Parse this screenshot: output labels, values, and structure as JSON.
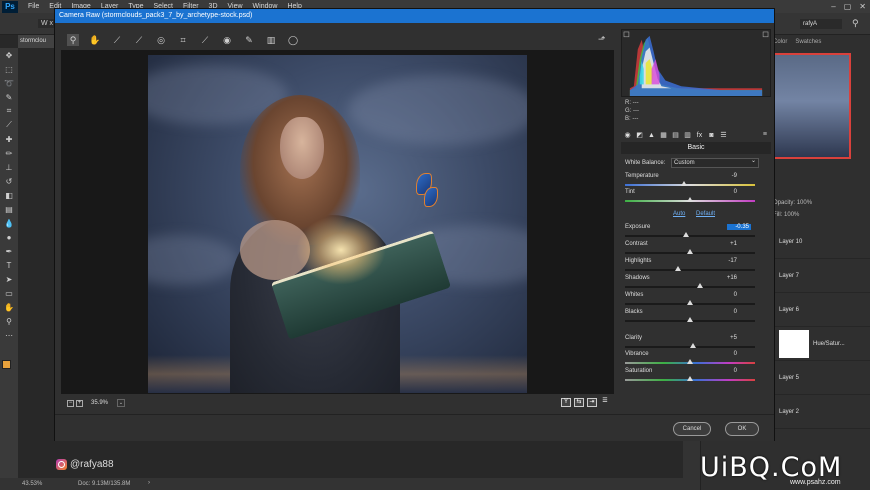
{
  "menubar": {
    "logo": "Ps",
    "items": [
      "File",
      "Edit",
      "Image",
      "Layer",
      "Type",
      "Select",
      "Filter",
      "3D",
      "View",
      "Window",
      "Help"
    ]
  },
  "options_bar": {
    "partial_label": "W x H",
    "user": "rafyA"
  },
  "doc_tab": "stormclou",
  "right_panel": {
    "tabs": [
      "Color",
      "Swatches"
    ],
    "opacity_label": "Opacity:",
    "opacity_value": "100%",
    "fill_label": "Fill:",
    "fill_value": "100%",
    "layers": [
      "Layer 10",
      "Layer 7",
      "Layer 6",
      "Hue/Satur...",
      "Layer 5",
      "Layer 2"
    ]
  },
  "camera_raw": {
    "title": "Camera Raw (stormclouds_pack3_7_by_archetype-stock.psd)",
    "zoom": "35.9%",
    "histogram": {
      "r": "R:",
      "g": "G:",
      "b": "B:",
      "placeholder": "---"
    },
    "section_title": "Basic",
    "white_balance_label": "White Balance:",
    "white_balance_value": "Custom",
    "auto_label": "Auto",
    "default_label": "Default",
    "sliders": [
      {
        "label": "Temperature",
        "value": "-9",
        "position": 0.45
      },
      {
        "label": "Tint",
        "value": "0",
        "position": 0.5
      },
      {
        "label": "Exposure",
        "value": "-0.35",
        "position": 0.47
      },
      {
        "label": "Contrast",
        "value": "+1",
        "position": 0.5
      },
      {
        "label": "Highlights",
        "value": "-17",
        "position": 0.41
      },
      {
        "label": "Shadows",
        "value": "+16",
        "position": 0.58
      },
      {
        "label": "Whites",
        "value": "0",
        "position": 0.5
      },
      {
        "label": "Blacks",
        "value": "0",
        "position": 0.5
      },
      {
        "label": "Clarity",
        "value": "+5",
        "position": 0.52
      },
      {
        "label": "Vibrance",
        "value": "0",
        "position": 0.5
      },
      {
        "label": "Saturation",
        "value": "0",
        "position": 0.5
      }
    ],
    "cancel_label": "Cancel",
    "ok_label": "OK"
  },
  "status": {
    "zoom": "43.53%",
    "doc": "Doc: 9.13M/135.8M"
  },
  "watermark": {
    "instagram": "@rafya88",
    "brand": "UiBQ.CoM",
    "site": "www.psahz.com"
  },
  "colors": {
    "accent_blue": "#1b73d1",
    "foreground": "#e8a23c",
    "background": "#ffffff"
  }
}
